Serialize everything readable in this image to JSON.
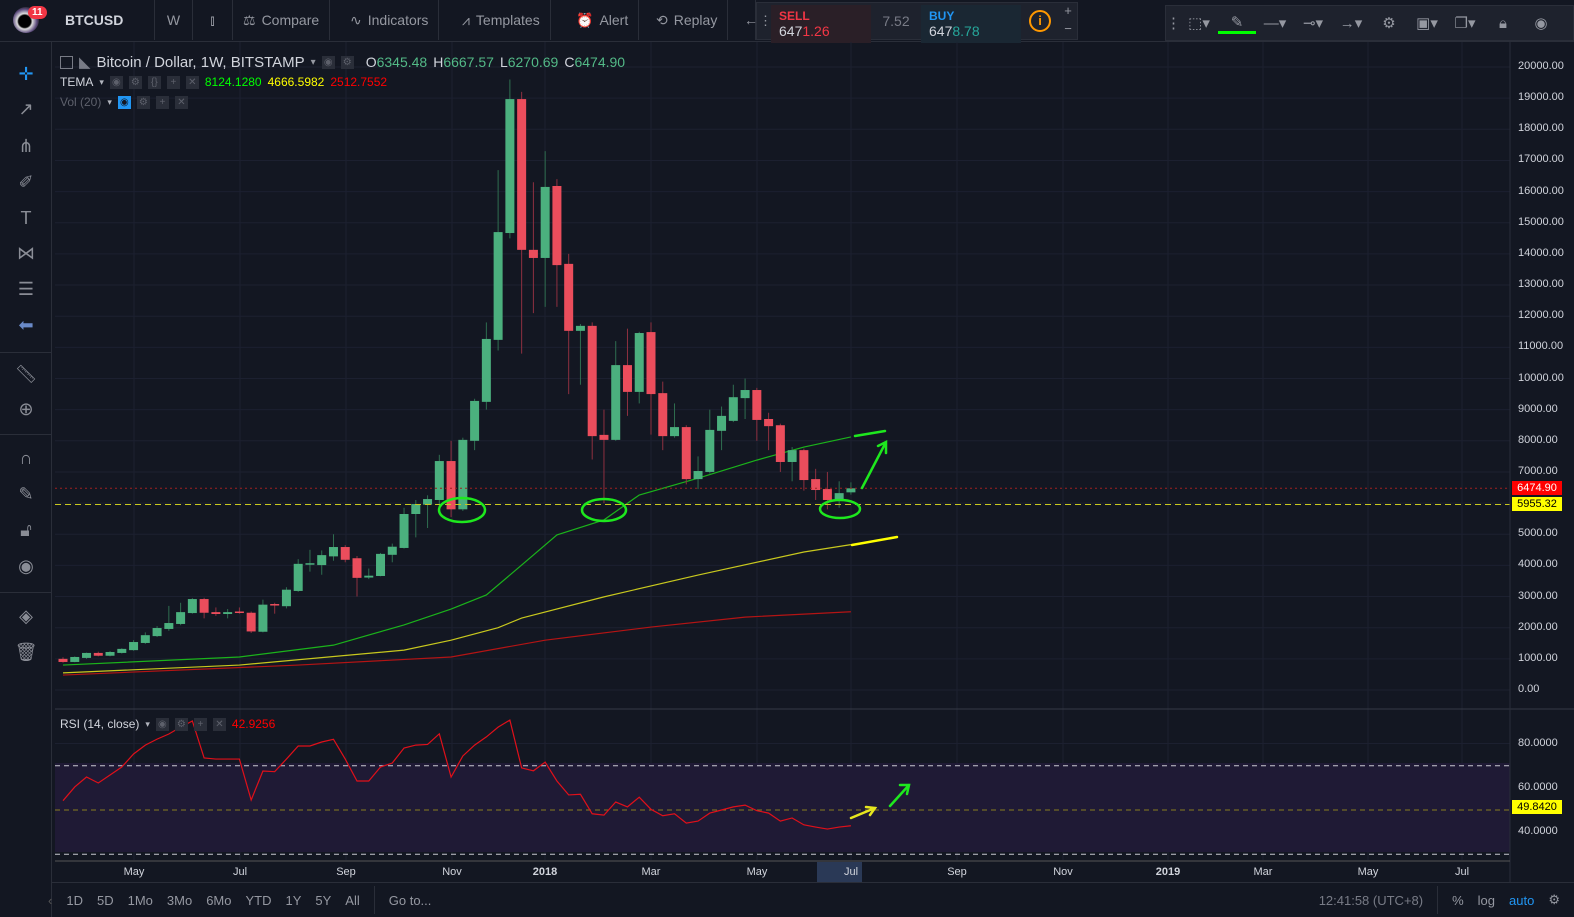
{
  "topbar": {
    "badge_count": "11",
    "symbol": "BTCUSD",
    "interval": "W",
    "compare": "Compare",
    "indicators": "Indicators",
    "templates": "Templates",
    "alert": "Alert",
    "replay": "Replay",
    "sell_label": "SELL",
    "sell_price_main": "647",
    "sell_price_tail": "1.26",
    "spread": "7.52",
    "buy_label": "BUY",
    "buy_price_main": "647",
    "buy_price_tail": "8.78",
    "plus": "+",
    "minus": "−"
  },
  "legend": {
    "title": "Bitcoin / Dollar, 1W, BITSTAMP",
    "o_label": "O",
    "o": "6345.48",
    "h_label": "H",
    "h": "6667.57",
    "l_label": "L",
    "l": "6270.69",
    "c_label": "C",
    "c": "6474.90",
    "tema_label": "TEMA",
    "tema1": "8124.1280",
    "tema2": "4666.5982",
    "tema3": "2512.7552",
    "vol_label": "Vol (20)",
    "rsi_label": "RSI (14, close)",
    "rsi_value": "42.9256"
  },
  "colors": {
    "up": "#4bb07e",
    "down": "#eb4d5c",
    "tema1": "#1bb31b",
    "tema2": "#c8c81e",
    "tema3": "#b41414",
    "rsi": "#e0101a",
    "accent": "#2196f3"
  },
  "price_axis": [
    "20000.00",
    "19000.00",
    "18000.00",
    "17000.00",
    "16000.00",
    "15000.00",
    "14000.00",
    "13000.00",
    "12000.00",
    "11000.00",
    "10000.00",
    "9000.00",
    "8000.00",
    "7000.00",
    "6000.00",
    "5000.00",
    "4000.00",
    "3000.00",
    "2000.00",
    "1000.00",
    "0.00"
  ],
  "price_tags": {
    "last": "6474.90",
    "line": "5955.32"
  },
  "rsi_axis": [
    "80.0000",
    "60.0000",
    "40.0000"
  ],
  "rsi_tag": "49.8420",
  "time_axis": [
    "May",
    "Jul",
    "Sep",
    "Nov",
    "2018",
    "Mar",
    "May",
    "Jul",
    "Sep",
    "Nov",
    "2019",
    "Mar",
    "May",
    "Jul"
  ],
  "bottombar": {
    "ranges": [
      "1D",
      "5D",
      "1Mo",
      "3Mo",
      "6Mo",
      "YTD",
      "1Y",
      "5Y",
      "All"
    ],
    "goto": "Go to...",
    "clock": "12:41:58 (UTC+8)",
    "percent": "%",
    "log": "log",
    "auto": "auto"
  },
  "chart_data": {
    "type": "candlestick",
    "title": "Bitcoin / Dollar, 1W, BITSTAMP",
    "ylim": [
      0,
      20000
    ],
    "hline_price": 5955.32,
    "last_price": 6474.9,
    "ohlc": [
      [
        1000,
        1050,
        880,
        900
      ],
      [
        900,
        1080,
        890,
        1060
      ],
      [
        1030,
        1200,
        1000,
        1190
      ],
      [
        1190,
        1230,
        1080,
        1100
      ],
      [
        1100,
        1250,
        1080,
        1220
      ],
      [
        1190,
        1340,
        1170,
        1320
      ],
      [
        1280,
        1600,
        1260,
        1540
      ],
      [
        1510,
        1850,
        1480,
        1760
      ],
      [
        1730,
        2050,
        1700,
        1990
      ],
      [
        1960,
        2700,
        1900,
        2150
      ],
      [
        2120,
        2800,
        2080,
        2500
      ],
      [
        2470,
        2950,
        2450,
        2920
      ],
      [
        2920,
        2960,
        2300,
        2480
      ],
      [
        2500,
        2650,
        2380,
        2440
      ],
      [
        2440,
        2600,
        2300,
        2500
      ],
      [
        2520,
        2650,
        2450,
        2480
      ],
      [
        2480,
        2520,
        1830,
        1880
      ],
      [
        1870,
        2900,
        1850,
        2740
      ],
      [
        2760,
        2800,
        2450,
        2720
      ],
      [
        2690,
        3300,
        2620,
        3220
      ],
      [
        3180,
        4200,
        3150,
        4050
      ],
      [
        4040,
        4500,
        3800,
        4070
      ],
      [
        4010,
        4480,
        3700,
        4330
      ],
      [
        4290,
        5000,
        4150,
        4590
      ],
      [
        4590,
        4650,
        4100,
        4180
      ],
      [
        4230,
        4300,
        3000,
        3600
      ],
      [
        3610,
        3900,
        3560,
        3670
      ],
      [
        3660,
        4400,
        3650,
        4370
      ],
      [
        4340,
        4700,
        4100,
        4600
      ],
      [
        4560,
        5850,
        4540,
        5650
      ],
      [
        5650,
        6100,
        4900,
        5970
      ],
      [
        5950,
        6250,
        5200,
        6130
      ],
      [
        6100,
        7550,
        5850,
        7350
      ],
      [
        7350,
        8000,
        5550,
        5800
      ],
      [
        5800,
        8100,
        5750,
        8030
      ],
      [
        8000,
        9350,
        7700,
        9280
      ],
      [
        9250,
        11800,
        9000,
        11270
      ],
      [
        11240,
        16690,
        10900,
        14700
      ],
      [
        14670,
        19600,
        14500,
        18970
      ],
      [
        18970,
        19200,
        10800,
        14130
      ],
      [
        14130,
        16300,
        12100,
        13870
      ],
      [
        13870,
        17300,
        12300,
        16150
      ],
      [
        16180,
        16400,
        12300,
        13640
      ],
      [
        13680,
        14000,
        9500,
        11530
      ],
      [
        11530,
        11750,
        9800,
        11690
      ],
      [
        11690,
        11800,
        7400,
        8150
      ],
      [
        8190,
        9000,
        6000,
        8030
      ],
      [
        8030,
        11200,
        8000,
        10430
      ],
      [
        10430,
        11600,
        8800,
        9570
      ],
      [
        9570,
        11500,
        9200,
        11460
      ],
      [
        11490,
        11800,
        8200,
        9500
      ],
      [
        9530,
        9900,
        7700,
        8150
      ],
      [
        8150,
        9200,
        8100,
        8440
      ],
      [
        8440,
        8500,
        6600,
        6770
      ],
      [
        6770,
        7500,
        6450,
        7030
      ],
      [
        7000,
        9000,
        6950,
        8350
      ],
      [
        8320,
        9100,
        7700,
        8800
      ],
      [
        8640,
        9800,
        8600,
        9400
      ],
      [
        9370,
        10000,
        8700,
        9630
      ],
      [
        9630,
        9700,
        8000,
        8670
      ],
      [
        8700,
        8900,
        7700,
        8470
      ],
      [
        8500,
        8550,
        7000,
        7320
      ],
      [
        7320,
        7800,
        6700,
        7700
      ],
      [
        7700,
        7750,
        6400,
        6740
      ],
      [
        6770,
        7100,
        6100,
        6420
      ],
      [
        6450,
        7000,
        5800,
        6100
      ],
      [
        6100,
        6700,
        5850,
        6320
      ],
      [
        6345.48,
        6667.57,
        6270.69,
        6474.9
      ]
    ],
    "tema": [
      {
        "name": "TEMA 1",
        "points": [
          [
            0,
            800
          ],
          [
            15,
            1060
          ],
          [
            23,
            1440
          ],
          [
            29,
            2090
          ],
          [
            33,
            2600
          ],
          [
            36,
            3050
          ],
          [
            39,
            4010
          ],
          [
            42,
            4980
          ],
          [
            46,
            5460
          ],
          [
            49,
            6260
          ],
          [
            54,
            6800
          ],
          [
            59,
            7380
          ],
          [
            63,
            7800
          ],
          [
            67,
            8124
          ]
        ]
      },
      {
        "name": "TEMA 2",
        "points": [
          [
            0,
            550
          ],
          [
            15,
            800
          ],
          [
            29,
            1280
          ],
          [
            33,
            1600
          ],
          [
            37,
            2000
          ],
          [
            39,
            2310
          ],
          [
            46,
            2990
          ],
          [
            54,
            3690
          ],
          [
            63,
            4430
          ],
          [
            67,
            4667
          ]
        ]
      },
      {
        "name": "TEMA 3",
        "points": [
          [
            0,
            480
          ],
          [
            20,
            800
          ],
          [
            33,
            1060
          ],
          [
            41,
            1600
          ],
          [
            50,
            2020
          ],
          [
            58,
            2340
          ],
          [
            67,
            2513
          ]
        ]
      }
    ],
    "rsi": {
      "ylim": [
        30,
        90
      ],
      "bands": [
        70,
        50,
        30
      ],
      "values": [
        54.2,
        60.4,
        64.9,
        62.2,
        65.8,
        69.4,
        75.3,
        79.3,
        82,
        84.3,
        87.4,
        90.2,
        73.5,
        73,
        73,
        73,
        54.5,
        67.6,
        67.3,
        73,
        78.9,
        78.9,
        80.7,
        81.9,
        73,
        63.1,
        63.1,
        69.4,
        71.2,
        78,
        79.3,
        79.6,
        84.4,
        64.9,
        74.4,
        79.3,
        83,
        87.4,
        90.6,
        69,
        67.7,
        71.6,
        63.1,
        56.8,
        57.1,
        48.3,
        47.7,
        53.6,
        51.4,
        55.8,
        50.3,
        47.4,
        48.3,
        44.1,
        45,
        48.6,
        50,
        51.4,
        52.2,
        49.7,
        48.6,
        45,
        46.4,
        43.3,
        42.3,
        41.4,
        42.3,
        42.9
      ]
    }
  }
}
